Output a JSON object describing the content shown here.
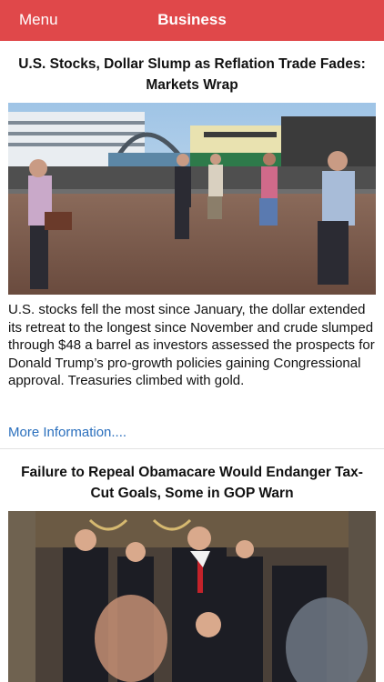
{
  "nav": {
    "menu_label": "Menu",
    "title": "Business"
  },
  "articles": [
    {
      "headline": "U.S. Stocks, Dollar Slump as Reflation Trade Fades: Markets Wrap",
      "summary": "U.S. stocks fell the most since January, the dollar extended its retreat to the longest since November and crude slumped through $48 a barrel as investors assessed the prospects for Donald Trump’s pro-growth policies gaining Congressional approval. Treasuries climbed with gold.",
      "more_label": "More Information...."
    },
    {
      "headline": "Failure to Repeal Obamacare Would Endanger Tax-Cut Goals, Some in GOP Warn"
    }
  ]
}
